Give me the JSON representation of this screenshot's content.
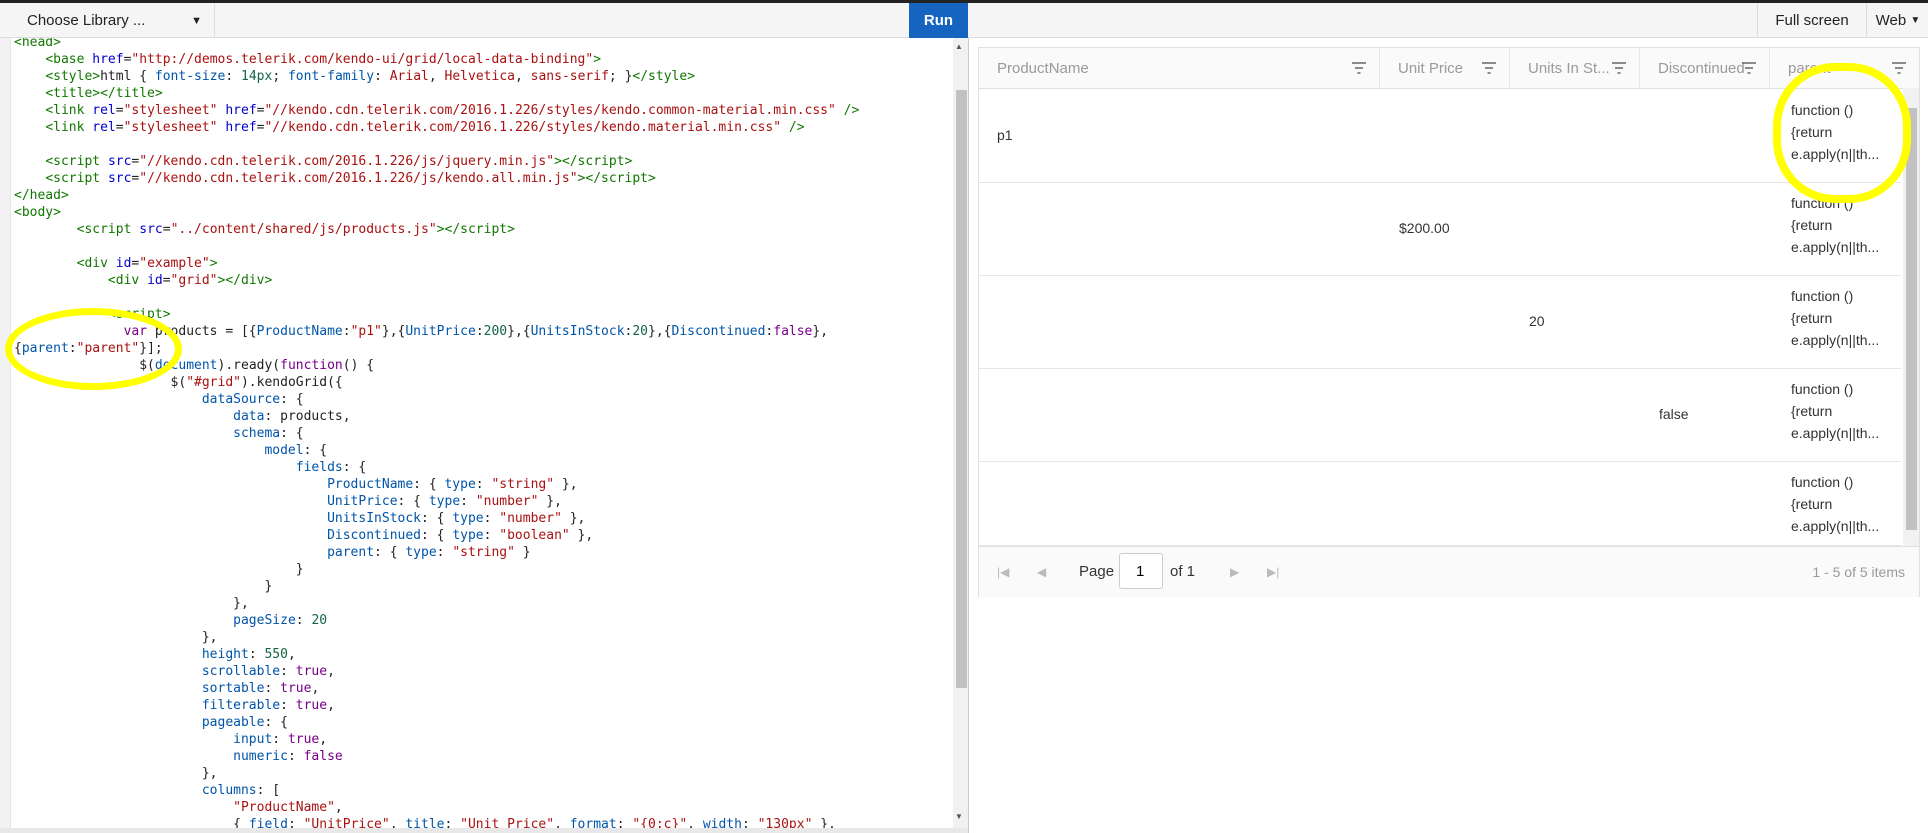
{
  "toolbar": {
    "library_label": "Choose Library ...",
    "run_label": "Run",
    "fullscreen_label": "Full screen",
    "web_label": "Web"
  },
  "grid": {
    "columns": [
      "ProductName",
      "Unit Price",
      "Units In St...",
      "Discontinued",
      "parent"
    ],
    "rows": [
      {
        "product": "p1",
        "price": "",
        "units": "",
        "disc": "",
        "parent": [
          "function ()",
          "{return",
          "e.apply(n||th..."
        ]
      },
      {
        "product": "",
        "price": "$200.00",
        "units": "",
        "disc": "",
        "parent": [
          "function ()",
          "{return",
          "e.apply(n||th..."
        ]
      },
      {
        "product": "",
        "price": "",
        "units": "20",
        "disc": "",
        "parent": [
          "function ()",
          "{return",
          "e.apply(n||th..."
        ]
      },
      {
        "product": "",
        "price": "",
        "units": "",
        "disc": "false",
        "parent": [
          "function ()",
          "{return",
          "e.apply(n||th..."
        ]
      },
      {
        "product": "",
        "price": "",
        "units": "",
        "disc": "",
        "parent": [
          "function ()",
          "{return",
          "e.apply(n||th..."
        ]
      }
    ],
    "pager": {
      "page_label": "Page",
      "page_value": "1",
      "of_label": "of 1",
      "info": "1 - 5 of 5 items"
    }
  },
  "icons": [
    "chevron-down-icon",
    "filter-icon",
    "first-page-icon",
    "prev-page-icon",
    "next-page-icon",
    "last-page-icon"
  ]
}
